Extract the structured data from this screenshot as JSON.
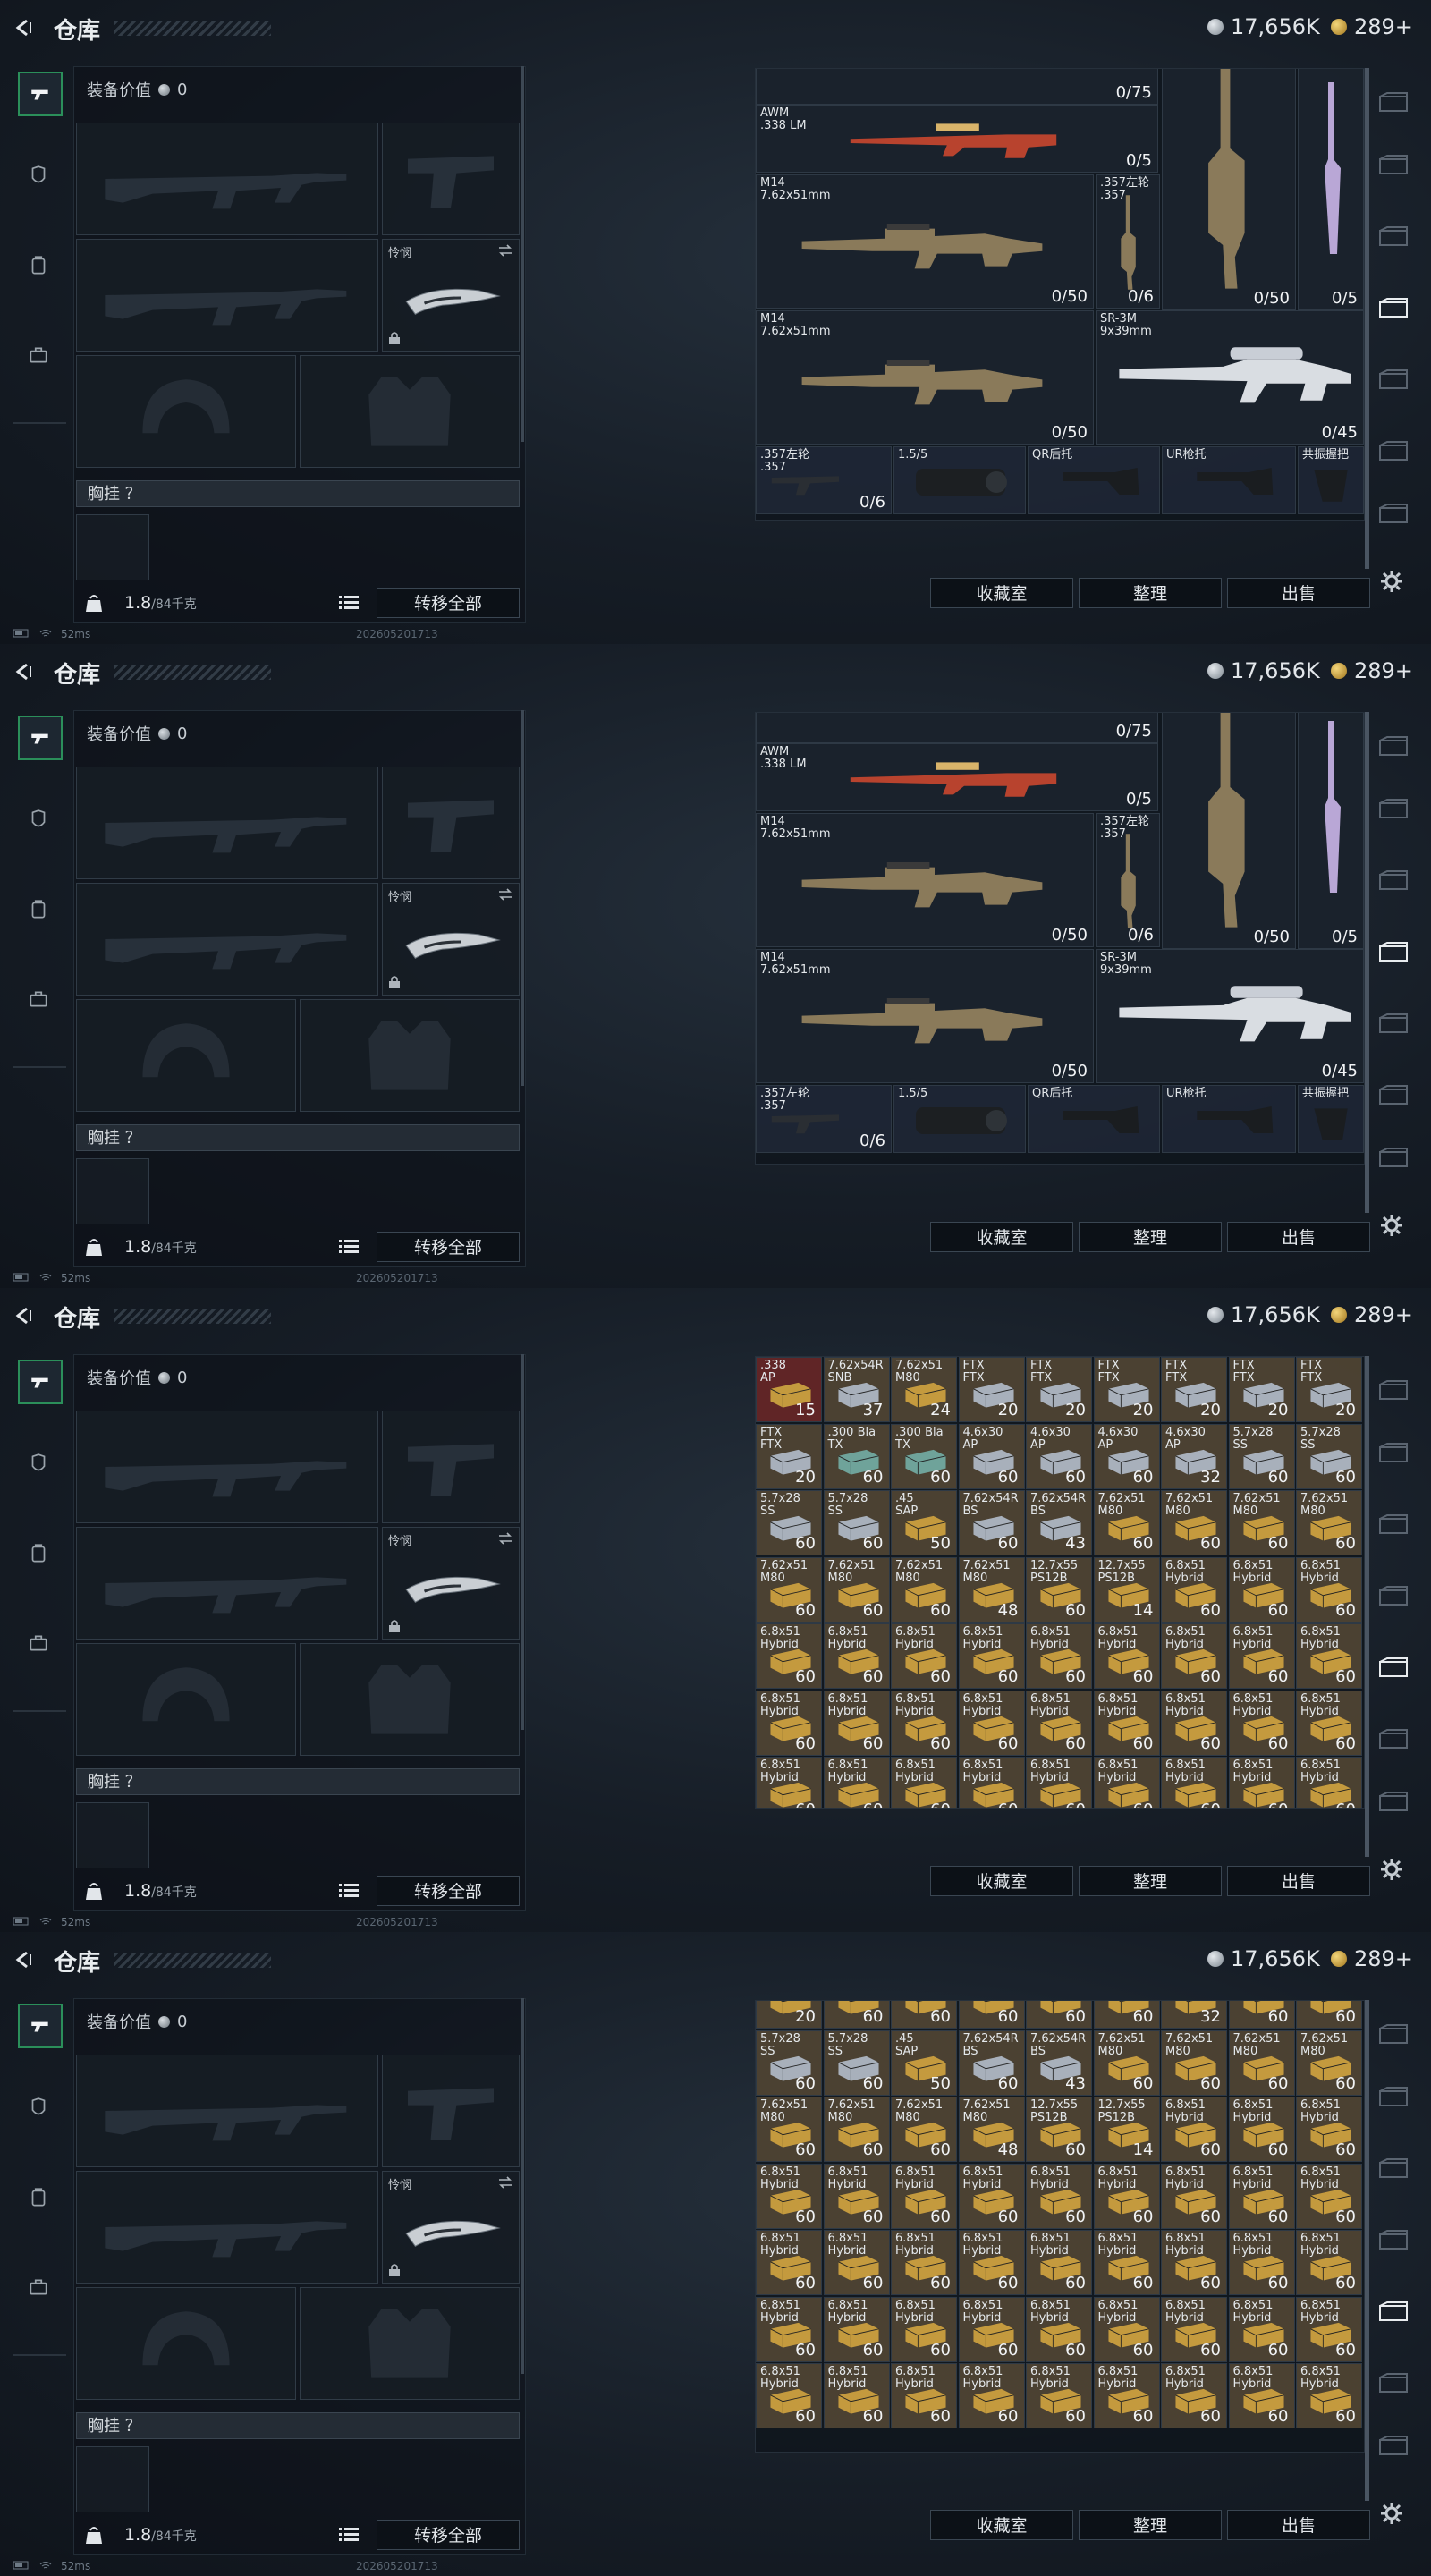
{
  "header": {
    "title": "仓库",
    "silver": "17,656K",
    "gold": "289+"
  },
  "loadout": {
    "value_label": "装备价值",
    "value": "0",
    "melee_label": "怜悯",
    "chest_label": "胸挂 ？",
    "weight": "1.8",
    "weight_max": "/84千克",
    "transfer_all": "转移全部"
  },
  "actions": {
    "collection": "收藏室",
    "sort": "整理",
    "sell": "出售"
  },
  "status": {
    "ping": "52ms",
    "build": "202605201713"
  },
  "weapons_view": {
    "top_count": "0/75",
    "items": [
      {
        "name": "AWM\n.338 LM",
        "count": "0/5"
      },
      {
        "name": "M14\n7.62x51mm",
        "count": "0/50"
      },
      {
        "name": ".357左轮\n.357",
        "count": "0/6"
      },
      {
        "name": "",
        "count": "0/50"
      },
      {
        "name": "",
        "count": "0/5"
      },
      {
        "name": "M14\n7.62x51mm",
        "count": "0/50"
      },
      {
        "name": "SR-3M\n9x39mm",
        "count": "0/45"
      },
      {
        "name": ".357左轮\n.357",
        "count": "0/6"
      },
      {
        "name": "1.5/5",
        "count": ""
      },
      {
        "name": "QR后托",
        "count": ""
      },
      {
        "name": "UR枪托",
        "count": ""
      },
      {
        "name": "共振握把",
        "count": ""
      }
    ]
  },
  "ammo_view_1": {
    "rows": [
      [
        {
          "n": ".338\nAP",
          "c": "15"
        },
        {
          "n": "7.62x54R\nSNB",
          "c": "37"
        },
        {
          "n": "7.62x51\nM80",
          "c": "24"
        },
        {
          "n": "FTX\nFTX",
          "c": "20"
        },
        {
          "n": "FTX\nFTX",
          "c": "20"
        },
        {
          "n": "FTX\nFTX",
          "c": "20"
        },
        {
          "n": "FTX\nFTX",
          "c": "20"
        },
        {
          "n": "FTX\nFTX",
          "c": "20"
        },
        {
          "n": "FTX\nFTX",
          "c": "20"
        }
      ],
      [
        {
          "n": "FTX\nFTX",
          "c": "20"
        },
        {
          "n": ".300 Bla\nTX",
          "c": "60"
        },
        {
          "n": ".300 Bla\nTX",
          "c": "60"
        },
        {
          "n": "4.6x30\nAP",
          "c": "60"
        },
        {
          "n": "4.6x30\nAP",
          "c": "60"
        },
        {
          "n": "4.6x30\nAP",
          "c": "60"
        },
        {
          "n": "4.6x30\nAP",
          "c": "32"
        },
        {
          "n": "5.7x28\nSS",
          "c": "60"
        },
        {
          "n": "5.7x28\nSS",
          "c": "60"
        }
      ],
      [
        {
          "n": "5.7x28\nSS",
          "c": "60"
        },
        {
          "n": "5.7x28\nSS",
          "c": "60"
        },
        {
          "n": ".45\nSAP",
          "c": "50"
        },
        {
          "n": "7.62x54R\nBS",
          "c": "60"
        },
        {
          "n": "7.62x54R\nBS",
          "c": "43"
        },
        {
          "n": "7.62x51\nM80",
          "c": "60"
        },
        {
          "n": "7.62x51\nM80",
          "c": "60"
        },
        {
          "n": "7.62x51\nM80",
          "c": "60"
        },
        {
          "n": "7.62x51\nM80",
          "c": "60"
        }
      ],
      [
        {
          "n": "7.62x51\nM80",
          "c": "60"
        },
        {
          "n": "7.62x51\nM80",
          "c": "60"
        },
        {
          "n": "7.62x51\nM80",
          "c": "60"
        },
        {
          "n": "7.62x51\nM80",
          "c": "48"
        },
        {
          "n": "12.7x55\nPS12B",
          "c": "60"
        },
        {
          "n": "12.7x55\nPS12B",
          "c": "14"
        },
        {
          "n": "6.8x51\nHybrid",
          "c": "60"
        },
        {
          "n": "6.8x51\nHybrid",
          "c": "60"
        },
        {
          "n": "6.8x51\nHybrid",
          "c": "60"
        }
      ],
      [
        {
          "n": "6.8x51\nHybrid",
          "c": "60"
        },
        {
          "n": "6.8x51\nHybrid",
          "c": "60"
        },
        {
          "n": "6.8x51\nHybrid",
          "c": "60"
        },
        {
          "n": "6.8x51\nHybrid",
          "c": "60"
        },
        {
          "n": "6.8x51\nHybrid",
          "c": "60"
        },
        {
          "n": "6.8x51\nHybrid",
          "c": "60"
        },
        {
          "n": "6.8x51\nHybrid",
          "c": "60"
        },
        {
          "n": "6.8x51\nHybrid",
          "c": "60"
        },
        {
          "n": "6.8x51\nHybrid",
          "c": "60"
        }
      ],
      [
        {
          "n": "6.8x51\nHybrid",
          "c": "60"
        },
        {
          "n": "6.8x51\nHybrid",
          "c": "60"
        },
        {
          "n": "6.8x51\nHybrid",
          "c": "60"
        },
        {
          "n": "6.8x51\nHybrid",
          "c": "60"
        },
        {
          "n": "6.8x51\nHybrid",
          "c": "60"
        },
        {
          "n": "6.8x51\nHybrid",
          "c": "60"
        },
        {
          "n": "6.8x51\nHybrid",
          "c": "60"
        },
        {
          "n": "6.8x51\nHybrid",
          "c": "60"
        },
        {
          "n": "6.8x51\nHybrid",
          "c": "60"
        }
      ],
      [
        {
          "n": "6.8x51\nHybrid",
          "c": "60"
        },
        {
          "n": "6.8x51\nHybrid",
          "c": "60"
        },
        {
          "n": "6.8x51\nHybrid",
          "c": "60"
        },
        {
          "n": "6.8x51\nHybrid",
          "c": "60"
        },
        {
          "n": "6.8x51\nHybrid",
          "c": "60"
        },
        {
          "n": "6.8x51\nHybrid",
          "c": "60"
        },
        {
          "n": "6.8x51\nHybrid",
          "c": "60"
        },
        {
          "n": "6.8x51\nHybrid",
          "c": "60"
        },
        {
          "n": "6.8x51\nHybrid",
          "c": "60"
        }
      ],
      [
        {
          "n": "6.8x51\nHybrid",
          "c": ""
        },
        {
          "n": "6.8x51\nHybrid",
          "c": ""
        },
        {
          "n": "6.8x51\nHybrid",
          "c": ""
        },
        {
          "n": "6.8x51\nHybrid",
          "c": ""
        },
        {
          "n": "6.8x51\nHybrid",
          "c": ""
        },
        {
          "n": "6.8x51\nHybrid",
          "c": ""
        },
        {
          "n": "6.8x51\nHybrid",
          "c": ""
        },
        {
          "n": "6.8x51\nHybrid",
          "c": ""
        },
        {
          "n": "6.8x51\nHybrid",
          "c": ""
        }
      ]
    ]
  },
  "ammo_view_2": {
    "rows": [
      [
        {
          "n": "",
          "c": "20"
        },
        {
          "n": "",
          "c": "60"
        },
        {
          "n": "",
          "c": "60"
        },
        {
          "n": "",
          "c": "60"
        },
        {
          "n": "",
          "c": "60"
        },
        {
          "n": "",
          "c": "60"
        },
        {
          "n": "",
          "c": "32"
        },
        {
          "n": "",
          "c": "60"
        },
        {
          "n": "",
          "c": "60"
        }
      ],
      [
        {
          "n": "5.7x28\nSS",
          "c": "60"
        },
        {
          "n": "5.7x28\nSS",
          "c": "60"
        },
        {
          "n": ".45\nSAP",
          "c": "50"
        },
        {
          "n": "7.62x54R\nBS",
          "c": "60"
        },
        {
          "n": "7.62x54R\nBS",
          "c": "43"
        },
        {
          "n": "7.62x51\nM80",
          "c": "60"
        },
        {
          "n": "7.62x51\nM80",
          "c": "60"
        },
        {
          "n": "7.62x51\nM80",
          "c": "60"
        },
        {
          "n": "7.62x51\nM80",
          "c": "60"
        }
      ],
      [
        {
          "n": "7.62x51\nM80",
          "c": "60"
        },
        {
          "n": "7.62x51\nM80",
          "c": "60"
        },
        {
          "n": "7.62x51\nM80",
          "c": "60"
        },
        {
          "n": "7.62x51\nM80",
          "c": "48"
        },
        {
          "n": "12.7x55\nPS12B",
          "c": "60"
        },
        {
          "n": "12.7x55\nPS12B",
          "c": "14"
        },
        {
          "n": "6.8x51\nHybrid",
          "c": "60"
        },
        {
          "n": "6.8x51\nHybrid",
          "c": "60"
        },
        {
          "n": "6.8x51\nHybrid",
          "c": "60"
        }
      ],
      [
        {
          "n": "6.8x51\nHybrid",
          "c": "60"
        },
        {
          "n": "6.8x51\nHybrid",
          "c": "60"
        },
        {
          "n": "6.8x51\nHybrid",
          "c": "60"
        },
        {
          "n": "6.8x51\nHybrid",
          "c": "60"
        },
        {
          "n": "6.8x51\nHybrid",
          "c": "60"
        },
        {
          "n": "6.8x51\nHybrid",
          "c": "60"
        },
        {
          "n": "6.8x51\nHybrid",
          "c": "60"
        },
        {
          "n": "6.8x51\nHybrid",
          "c": "60"
        },
        {
          "n": "6.8x51\nHybrid",
          "c": "60"
        }
      ],
      [
        {
          "n": "6.8x51\nHybrid",
          "c": "60"
        },
        {
          "n": "6.8x51\nHybrid",
          "c": "60"
        },
        {
          "n": "6.8x51\nHybrid",
          "c": "60"
        },
        {
          "n": "6.8x51\nHybrid",
          "c": "60"
        },
        {
          "n": "6.8x51\nHybrid",
          "c": "60"
        },
        {
          "n": "6.8x51\nHybrid",
          "c": "60"
        },
        {
          "n": "6.8x51\nHybrid",
          "c": "60"
        },
        {
          "n": "6.8x51\nHybrid",
          "c": "60"
        },
        {
          "n": "6.8x51\nHybrid",
          "c": "60"
        }
      ],
      [
        {
          "n": "6.8x51\nHybrid",
          "c": "60"
        },
        {
          "n": "6.8x51\nHybrid",
          "c": "60"
        },
        {
          "n": "6.8x51\nHybrid",
          "c": "60"
        },
        {
          "n": "6.8x51\nHybrid",
          "c": "60"
        },
        {
          "n": "6.8x51\nHybrid",
          "c": "60"
        },
        {
          "n": "6.8x51\nHybrid",
          "c": "60"
        },
        {
          "n": "6.8x51\nHybrid",
          "c": "60"
        },
        {
          "n": "6.8x51\nHybrid",
          "c": "60"
        },
        {
          "n": "6.8x51\nHybrid",
          "c": "60"
        }
      ],
      [
        {
          "n": "6.8x51\nHybrid",
          "c": "60"
        },
        {
          "n": "6.8x51\nHybrid",
          "c": "60"
        },
        {
          "n": "6.8x51\nHybrid",
          "c": "60"
        },
        {
          "n": "6.8x51\nHybrid",
          "c": "60"
        },
        {
          "n": "6.8x51\nHybrid",
          "c": "60"
        },
        {
          "n": "6.8x51\nHybrid",
          "c": "60"
        },
        {
          "n": "6.8x51\nHybrid",
          "c": "60"
        },
        {
          "n": "6.8x51\nHybrid",
          "c": "60"
        },
        {
          "n": "6.8x51\nHybrid",
          "c": "60"
        }
      ]
    ]
  },
  "colors": {
    "accent_green": "#2b8f5a",
    "ammo_box": "#c49a3e",
    "ammo_tint": "#5a4a33"
  }
}
